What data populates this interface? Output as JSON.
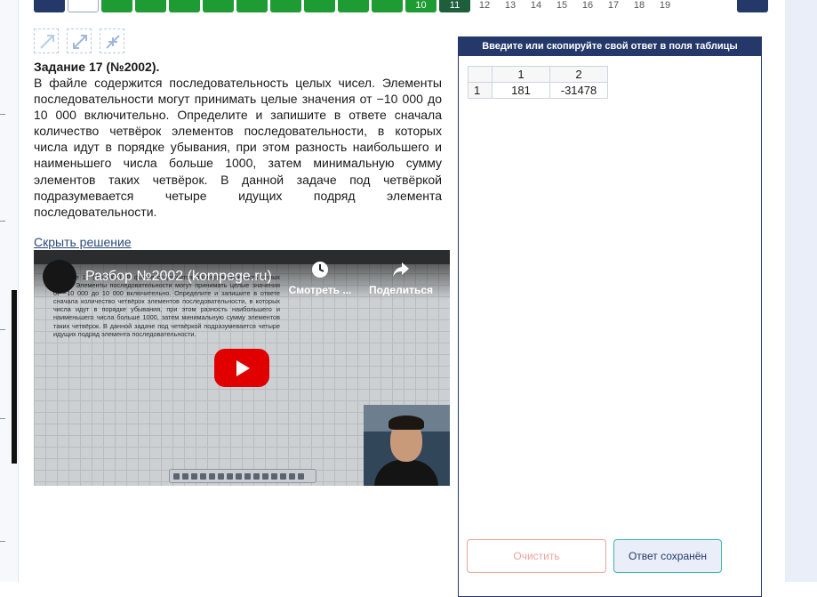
{
  "pagination": {
    "items": [
      {
        "label": "",
        "style": "navy"
      },
      {
        "label": "",
        "style": "white"
      },
      {
        "label": "",
        "style": "green"
      },
      {
        "label": "",
        "style": "green"
      },
      {
        "label": "",
        "style": "green"
      },
      {
        "label": "",
        "style": "green"
      },
      {
        "label": "",
        "style": "green"
      },
      {
        "label": "",
        "style": "green"
      },
      {
        "label": "",
        "style": "green"
      },
      {
        "label": "",
        "style": "green"
      },
      {
        "label": "",
        "style": "green"
      },
      {
        "label": "10",
        "style": "green"
      },
      {
        "label": "11",
        "style": "dark"
      },
      {
        "label": "12",
        "style": "plain"
      },
      {
        "label": "13",
        "style": "plain"
      },
      {
        "label": "14",
        "style": "plain"
      },
      {
        "label": "15",
        "style": "plain"
      },
      {
        "label": "16",
        "style": "plain"
      },
      {
        "label": "17",
        "style": "plain"
      },
      {
        "label": "18",
        "style": "plain"
      },
      {
        "label": "19",
        "style": "plain"
      }
    ]
  },
  "toolbar_icons": [
    "fullscreen-enter-icon",
    "expand-icon",
    "collapse-icon"
  ],
  "task": {
    "title": "Задание 17 (№2002).",
    "text": "В файле содержится последовательность целых чисел. Элементы последовательности могут принимать целые значения от −10 000 до 10 000 включительно. Определите и запишите в ответе сначала количество четвёрок элементов последовательности, в которых числа идут в порядке убывания, при этом разность наибольшего и наименьшего числа больше 1000, затем минимальную сумму элементов таких четвёрок. В данной задаче под четвёркой подразумевается четыре идущих подряд элемента последовательности.",
    "hide_solution_link": "Скрыть решение"
  },
  "video": {
    "title": "Разбор №2002 (kompege.ru)",
    "watch_later_label": "Смотреть ...",
    "share_label": "Поделиться",
    "board_text": "Задание 17 (№2002). В файле содержится последовательность целых чисел. Элементы последовательности могут принимать целые значения от −10 000 до 10 000 включительно. Определите и запишите в ответе сначала количество четвёрок элементов последовательности, в которых числа идут в порядке убывания, при этом разность наибольшего и наименьшего числа больше 1000, затем минимальную сумму элементов таких четвёрок. В данной задаче под четвёркой подразумевается четыре идущих подряд элемента последовательности."
  },
  "answer_panel": {
    "header": "Введите или скопируйте свой ответ в поля таблицы",
    "columns": [
      "1",
      "2"
    ],
    "rows": [
      {
        "label": "1",
        "values": [
          "181",
          "-31478"
        ]
      }
    ],
    "clear_button": "Очистить",
    "saved_button": "Ответ сохранён"
  },
  "colors": {
    "navy": "#24396a",
    "green": "#1e9b32",
    "dark_green": "#1e5e3a",
    "clear_red": "#e9a4a0",
    "saved_teal": "#39b9a3",
    "youtube_red": "#e00000"
  }
}
